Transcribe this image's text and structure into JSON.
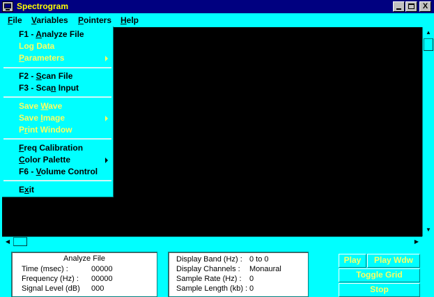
{
  "window": {
    "title": "Spectrogram",
    "controls": {
      "minimize": "_",
      "maximize": "□",
      "close": "X"
    }
  },
  "menubar": {
    "items": [
      {
        "label": "File",
        "accel": "F",
        "rest": "ile",
        "active": true
      },
      {
        "label": "Variables",
        "accel": "V",
        "rest": "ariables"
      },
      {
        "label": "Pointers",
        "accel": "P",
        "rest": "ointers"
      },
      {
        "label": "Help",
        "accel": "H",
        "rest": "elp"
      }
    ]
  },
  "file_menu": {
    "items": [
      {
        "pre": "F1 - ",
        "accel": "A",
        "post": "nalyze File",
        "enabled": true
      },
      {
        "pre": "Lo",
        "accel": "g",
        "post": " Data",
        "enabled": false
      },
      {
        "pre": "",
        "accel": "P",
        "post": "arameters",
        "enabled": false,
        "submenu": true
      },
      {
        "pre": "F2 - ",
        "accel": "S",
        "post": "can File",
        "enabled": true
      },
      {
        "pre": "F3 - Sca",
        "accel": "n",
        "post": " Input",
        "enabled": true
      },
      {
        "pre": "Save ",
        "accel": "W",
        "post": "ave",
        "enabled": false
      },
      {
        "pre": "Save ",
        "accel": "I",
        "post": "mage",
        "enabled": false,
        "submenu": true
      },
      {
        "pre": "P",
        "accel": "r",
        "post": "int Window",
        "enabled": false
      },
      {
        "pre": "",
        "accel": "F",
        "post": "req Calibration",
        "enabled": true
      },
      {
        "pre": "",
        "accel": "C",
        "post": "olor Palette",
        "enabled": true,
        "submenu": true
      },
      {
        "pre": "F6 - ",
        "accel": "V",
        "post": "olume Control",
        "enabled": true
      },
      {
        "pre": "E",
        "accel": "x",
        "post": "it",
        "enabled": true
      }
    ]
  },
  "analyze_panel": {
    "title": "Analyze File",
    "rows": [
      {
        "label": "Time (msec) :",
        "value": "00000"
      },
      {
        "label": "Frequency (Hz) :",
        "value": "00000"
      },
      {
        "label": "Signal Level (dB)",
        "value": "000"
      }
    ]
  },
  "display_panel": {
    "rows": [
      {
        "label": "Display Band (Hz) :",
        "value": "0 to 0"
      },
      {
        "label": "Display Channels :",
        "value": "Monaural"
      },
      {
        "label": "Sample Rate (Hz) :",
        "value": "0"
      },
      {
        "label": "Sample Length (kb) :",
        "value": "0"
      }
    ]
  },
  "buttons": {
    "play": "Play",
    "play_wdw": "Play Wdw",
    "toggle_grid": "Toggle Grid",
    "stop": "Stop"
  },
  "colors": {
    "titlebar": "#000080",
    "title_text": "#ffff00",
    "background": "#00ffff",
    "canvas": "#000000",
    "disabled_text": "#ffff60"
  }
}
